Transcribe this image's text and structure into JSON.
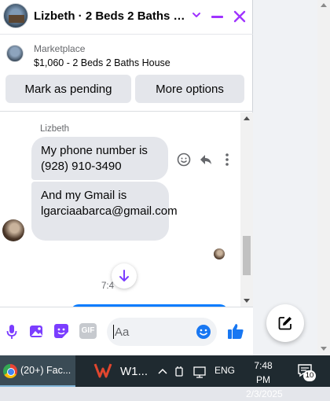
{
  "chat": {
    "title": "Lizbeth · 2 Beds 2 Baths H...",
    "marketplace_label": "Marketplace",
    "listing": "$1,060 - 2 Beds 2 Baths House",
    "mark_pending_label": "Mark as pending",
    "more_options_label": "More options"
  },
  "conversation": {
    "sender_name": "Lizbeth",
    "messages": [
      "My phone number is (928) 910-3490",
      "And my Gmail is lgarciaabarca@gmail.com"
    ],
    "time_separator": "7:4  "
  },
  "composer": {
    "placeholder": "Aa",
    "gif_label": "GIF"
  },
  "taskbar": {
    "browser_label": "(20+) Fac...",
    "app_label": "W1...",
    "language": "ENG",
    "time": "7:48 PM",
    "date": "2/3/2025",
    "notification_count": "10"
  },
  "colors": {
    "accent": "#a033ff",
    "messenger_blue": "#0a7cff",
    "bubble_gray": "#e4e6eb"
  }
}
